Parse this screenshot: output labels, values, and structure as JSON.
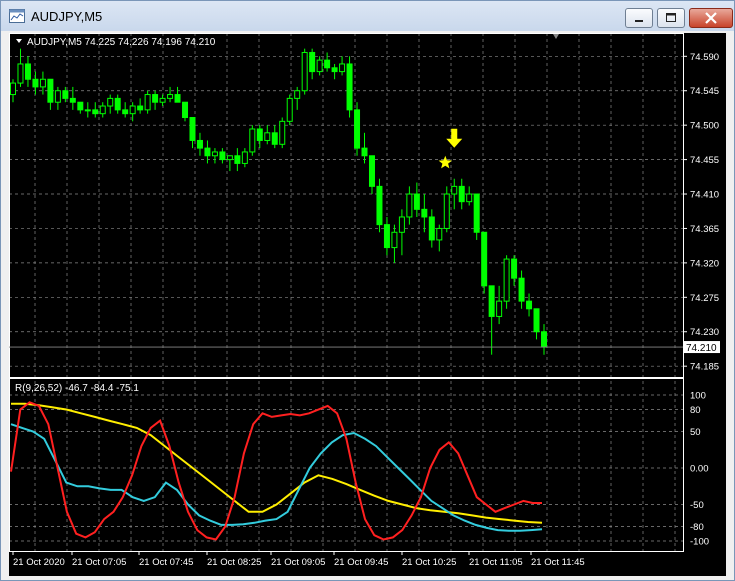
{
  "window": {
    "title": "AUDJPY,M5"
  },
  "chart": {
    "header": "AUDJPY,M5  74.225 74.226 74.196 74.210",
    "price_ticks": [
      "74.590",
      "74.545",
      "74.500",
      "74.455",
      "74.410",
      "74.365",
      "74.320",
      "74.275",
      "74.230",
      "74.185"
    ],
    "current_price": "74.210",
    "time_ticks": [
      "21 Oct 2020",
      "21 Oct 07:05",
      "21 Oct 07:45",
      "21 Oct 08:25",
      "21 Oct 09:05",
      "21 Oct 09:45",
      "21 Oct 10:25",
      "21 Oct 11:05",
      "21 Oct 11:45"
    ],
    "colors": {
      "background": "#000000",
      "grid": "#8a8a8a",
      "bull_candle": "#ffffff",
      "bear_candle": "#00ff00",
      "arrow": "#ffff00"
    }
  },
  "indicator": {
    "header": "R(9,26,52) -46.7 -84.4 -75.1",
    "ticks": [
      "100",
      "80",
      "50",
      "0.00",
      "-50",
      "-80",
      "-100"
    ],
    "colors": {
      "fast": "#ff2020",
      "mid": "#33ccdd",
      "slow": "#ffee00"
    }
  },
  "chart_data": {
    "type": "candlestick",
    "price_range": [
      74.18,
      74.61
    ],
    "indicator_range": [
      -100,
      100
    ],
    "candles": [
      [
        74.54,
        74.56,
        74.53,
        74.555
      ],
      [
        74.555,
        74.6,
        74.55,
        74.58
      ],
      [
        74.58,
        74.59,
        74.55,
        74.56
      ],
      [
        74.56,
        74.57,
        74.54,
        74.55
      ],
      [
        74.55,
        74.57,
        74.54,
        74.56
      ],
      [
        74.56,
        74.56,
        74.52,
        74.53
      ],
      [
        74.53,
        74.55,
        74.52,
        74.545
      ],
      [
        74.545,
        74.55,
        74.53,
        74.535
      ],
      [
        74.535,
        74.55,
        74.52,
        74.53
      ],
      [
        74.53,
        74.53,
        74.515,
        74.52
      ],
      [
        74.52,
        74.53,
        74.51,
        74.52
      ],
      [
        74.52,
        74.53,
        74.51,
        74.515
      ],
      [
        74.515,
        74.53,
        74.51,
        74.525
      ],
      [
        74.525,
        74.54,
        74.515,
        74.535
      ],
      [
        74.535,
        74.54,
        74.515,
        74.52
      ],
      [
        74.52,
        74.53,
        74.51,
        74.515
      ],
      [
        74.515,
        74.53,
        74.505,
        74.525
      ],
      [
        74.525,
        74.535,
        74.515,
        74.52
      ],
      [
        74.52,
        74.545,
        74.515,
        74.54
      ],
      [
        74.54,
        74.545,
        74.52,
        74.53
      ],
      [
        74.53,
        74.54,
        74.525,
        74.535
      ],
      [
        74.535,
        74.55,
        74.53,
        74.54
      ],
      [
        74.54,
        74.55,
        74.53,
        74.53
      ],
      [
        74.53,
        74.53,
        74.505,
        74.51
      ],
      [
        74.51,
        74.51,
        74.47,
        74.48
      ],
      [
        74.48,
        74.49,
        74.46,
        74.47
      ],
      [
        74.47,
        74.48,
        74.45,
        74.46
      ],
      [
        74.46,
        74.47,
        74.45,
        74.465
      ],
      [
        74.465,
        74.47,
        74.45,
        74.455
      ],
      [
        74.455,
        74.46,
        74.44,
        74.46
      ],
      [
        74.46,
        74.47,
        74.44,
        74.45
      ],
      [
        74.45,
        74.47,
        74.445,
        74.465
      ],
      [
        74.465,
        74.5,
        74.46,
        74.495
      ],
      [
        74.495,
        74.5,
        74.47,
        74.48
      ],
      [
        74.48,
        74.5,
        74.475,
        74.49
      ],
      [
        74.49,
        74.5,
        74.47,
        74.475
      ],
      [
        74.475,
        74.51,
        74.47,
        74.505
      ],
      [
        74.505,
        74.54,
        74.5,
        74.535
      ],
      [
        74.535,
        74.55,
        74.52,
        74.545
      ],
      [
        74.545,
        74.6,
        74.54,
        74.595
      ],
      [
        74.595,
        74.6,
        74.56,
        74.57
      ],
      [
        74.57,
        74.59,
        74.565,
        74.585
      ],
      [
        74.585,
        74.595,
        74.57,
        74.575
      ],
      [
        74.575,
        74.58,
        74.56,
        74.57
      ],
      [
        74.57,
        74.59,
        74.565,
        74.58
      ],
      [
        74.58,
        74.59,
        74.51,
        74.52
      ],
      [
        74.52,
        74.53,
        74.46,
        74.47
      ],
      [
        74.47,
        74.49,
        74.45,
        74.46
      ],
      [
        74.46,
        74.46,
        74.41,
        74.42
      ],
      [
        74.42,
        74.43,
        74.36,
        74.37
      ],
      [
        74.37,
        74.38,
        74.33,
        74.34
      ],
      [
        74.34,
        74.37,
        74.32,
        74.36
      ],
      [
        74.36,
        74.39,
        74.33,
        74.38
      ],
      [
        74.38,
        74.42,
        74.37,
        74.41
      ],
      [
        74.41,
        74.425,
        74.38,
        74.39
      ],
      [
        74.39,
        74.41,
        74.36,
        74.38
      ],
      [
        74.38,
        74.39,
        74.34,
        74.35
      ],
      [
        74.35,
        74.37,
        74.335,
        74.365
      ],
      [
        74.365,
        74.42,
        74.36,
        74.41
      ],
      [
        74.41,
        74.43,
        74.39,
        74.42
      ],
      [
        74.42,
        74.43,
        74.39,
        74.4
      ],
      [
        74.4,
        74.42,
        74.395,
        74.41
      ],
      [
        74.41,
        74.41,
        74.35,
        74.36
      ],
      [
        74.36,
        74.36,
        74.28,
        74.29
      ],
      [
        74.29,
        74.29,
        74.2,
        74.25
      ],
      [
        74.25,
        74.29,
        74.24,
        74.27
      ],
      [
        74.27,
        74.33,
        74.26,
        74.325
      ],
      [
        74.325,
        74.33,
        74.29,
        74.3
      ],
      [
        74.3,
        74.31,
        74.26,
        74.27
      ],
      [
        74.27,
        74.28,
        74.25,
        74.26
      ],
      [
        74.26,
        74.26,
        74.22,
        74.23
      ],
      [
        74.23,
        74.24,
        74.2,
        74.21
      ]
    ],
    "sell_signal_index": 59,
    "fast_line": [
      -5,
      80,
      90,
      85,
      60,
      0,
      -60,
      -90,
      -95,
      -88,
      -70,
      -60,
      -40,
      -10,
      30,
      55,
      65,
      30,
      -20,
      -60,
      -85,
      -95,
      -98,
      -80,
      -40,
      20,
      60,
      75,
      70,
      72,
      74,
      72,
      75,
      80,
      85,
      75,
      40,
      -20,
      -70,
      -92,
      -98,
      -95,
      -85,
      -65,
      -40,
      0,
      25,
      35,
      20,
      -10,
      -40,
      -50,
      -60,
      -55,
      -50,
      -45,
      -48,
      -48
    ],
    "mid_line": [
      60,
      55,
      50,
      40,
      10,
      -20,
      -25,
      -25,
      -28,
      -30,
      -30,
      -40,
      -45,
      -40,
      -20,
      -30,
      -50,
      -65,
      -72,
      -78,
      -78,
      -77,
      -75,
      -72,
      -70,
      -60,
      -30,
      0,
      20,
      35,
      45,
      48,
      40,
      30,
      15,
      0,
      -15,
      -30,
      -45,
      -55,
      -65,
      -72,
      -78,
      -82,
      -85,
      -86,
      -86,
      -85,
      -84
    ],
    "slow_line": [
      88,
      88,
      86,
      83,
      80,
      75,
      70,
      65,
      60,
      55,
      45,
      30,
      15,
      0,
      -15,
      -30,
      -45,
      -60,
      -60,
      -50,
      -35,
      -20,
      -10,
      -15,
      -22,
      -30,
      -38,
      -45,
      -50,
      -55,
      -58,
      -60,
      -62,
      -65,
      -68,
      -70,
      -72,
      -74,
      -75
    ]
  }
}
